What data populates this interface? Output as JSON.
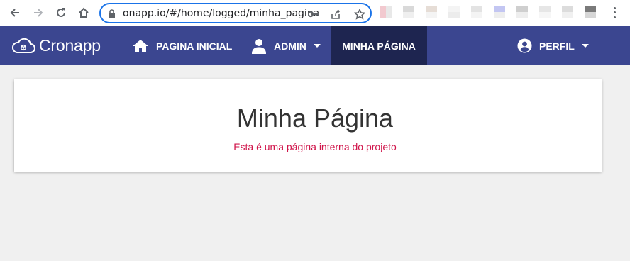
{
  "browser": {
    "url_host": "onapp.io",
    "url_path": "/#/home/logged/minha_pagina",
    "icons": [
      "back-arrow-icon",
      "forward-arrow-icon",
      "reload-icon",
      "home-icon",
      "lock-icon",
      "key-icon",
      "share-icon",
      "star-icon",
      "menu-dots-icon"
    ],
    "accent": "#1a73e8"
  },
  "navbar": {
    "brand": "Cronapp",
    "bg": "#3b4690",
    "active_bg": "#1e2550",
    "items": [
      {
        "label": "PAGINA INICIAL",
        "icon": "home-icon"
      },
      {
        "label": "ADMIN",
        "icon": "user-icon"
      },
      {
        "label": "MINHA PÁGINA",
        "active": true
      }
    ],
    "profile": {
      "label": "PERFIL",
      "icon": "account-circle-icon"
    }
  },
  "main": {
    "title": "Minha Página",
    "subtitle": "Esta é uma página interna do projeto",
    "subtitle_color": "#d0144a"
  }
}
